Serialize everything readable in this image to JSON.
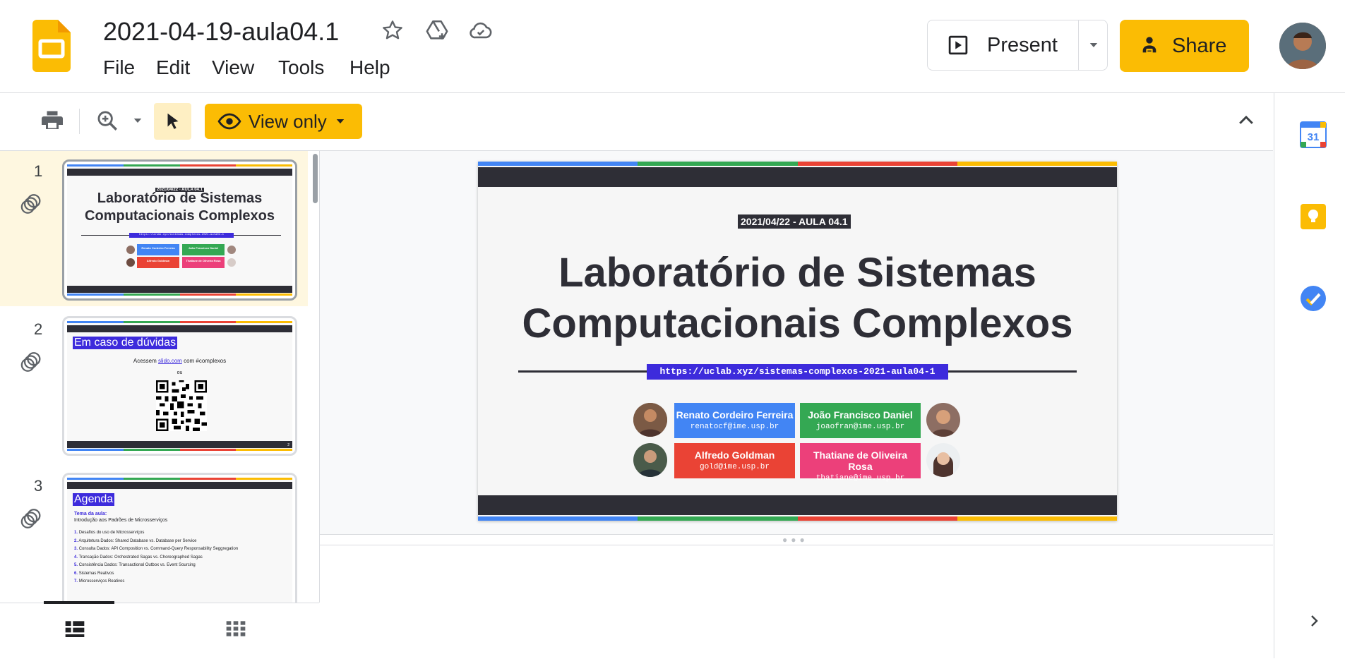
{
  "header": {
    "title": "2021-04-19-aula04.1",
    "menu": [
      "File",
      "Edit",
      "View",
      "Tools",
      "Help"
    ],
    "present_label": "Present",
    "share_label": "Share",
    "icons": [
      "star-icon",
      "drive-icon",
      "cloud-done-icon"
    ]
  },
  "toolbar": {
    "view_only_label": "View only",
    "icons": [
      "print-icon",
      "zoom-icon",
      "select-icon",
      "collapse-icon"
    ]
  },
  "filmstrip": {
    "slides": [
      {
        "number": "1",
        "tag": "2021/04/22 - AULA 04.1",
        "title_line1": "Laboratório de Sistemas",
        "title_line2": "Computacionais Complexos",
        "url": "https://uclab.xyz/sistemas-complexos-2021-aula04-1"
      },
      {
        "number": "2",
        "title": "Em caso de dúvidas",
        "line_prefix": "Acessem",
        "line_link": "slido.com",
        "line_suffix": "com #complexos",
        "or": "ou",
        "page": "2"
      },
      {
        "number": "3",
        "title": "Agenda",
        "subhead": "Tema da aula:",
        "subtitle": "Introdução aos Padrões de Microsserviços",
        "items": [
          "Desafios do uso de Microsserviços",
          "Arquitetura Dados: Shared Database vs. Database per Service",
          "Consulta Dados: API Composition vs. Command-Query Responsability Seggregation",
          "Transação Dados: Orchestrated Sagas vs. Choreographed Sagas",
          "Consistência Dados: Transactional Outbox vs. Event Sourcing",
          "Sistemas Reativos",
          "Microsserviços Reativos"
        ]
      }
    ]
  },
  "slide": {
    "tag": "2021/04/22 - AULA 04.1",
    "title_line1": "Laboratório de Sistemas",
    "title_line2": "Computacionais Complexos",
    "url": "https://uclab.xyz/sistemas-complexos-2021-aula04-1",
    "authors": [
      {
        "name": "Renato Cordeiro Ferreira",
        "email": "renatocf@ime.usp.br",
        "color": "#4285f4"
      },
      {
        "name": "João Francisco Daniel",
        "email": "joaofran@ime.usp.br",
        "color": "#34a853"
      },
      {
        "name": "Alfredo Goldman",
        "email": "gold@ime.usp.br",
        "color": "#ea4335"
      },
      {
        "name": "Thatiane de Oliveira Rosa",
        "email": "thatiane@ime.usp.br",
        "color": "#ec407a"
      }
    ]
  },
  "sidepanel": {
    "calendar_day": "31",
    "icons": [
      "calendar-icon",
      "keep-icon",
      "tasks-icon",
      "expand-panel-icon"
    ]
  },
  "colors": {
    "accent_yellow": "#fbbc04",
    "google_blue": "#4285f4",
    "google_green": "#34a853",
    "google_red": "#ea4335",
    "google_yellow": "#fbbc04",
    "slide_dark": "#2e2e36",
    "url_purple": "#3d2bdc"
  }
}
